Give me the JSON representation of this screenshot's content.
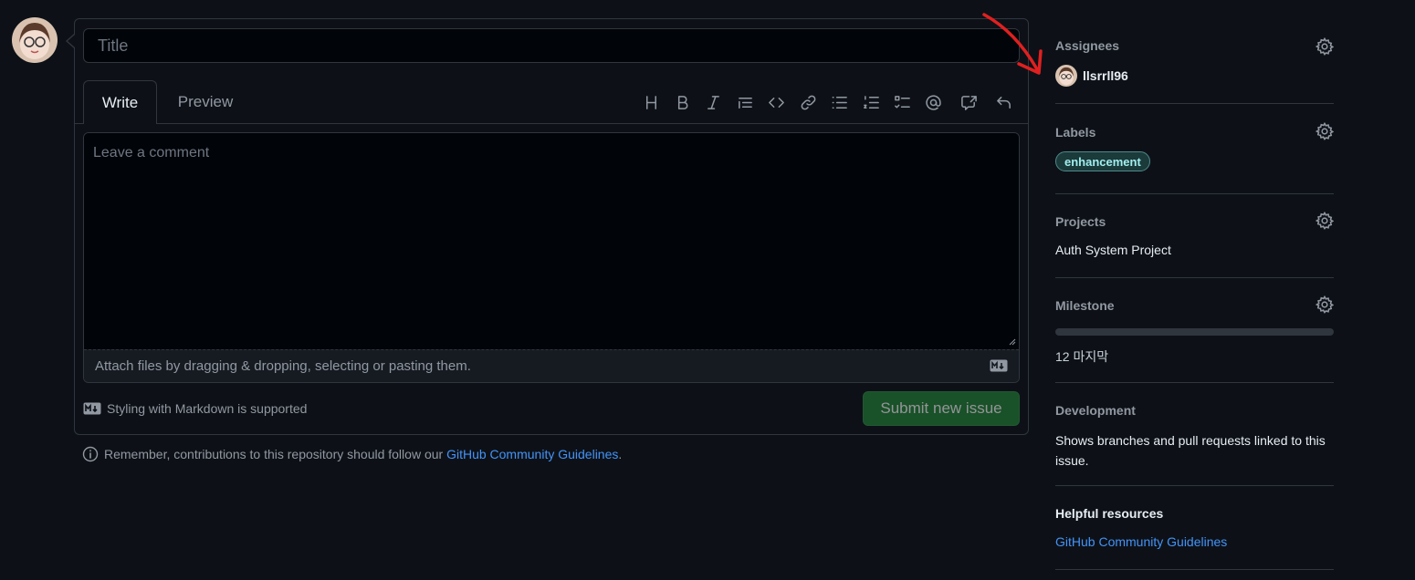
{
  "form": {
    "title_placeholder": "Title",
    "tabs": [
      {
        "label": "Write"
      },
      {
        "label": "Preview"
      }
    ],
    "toolbar_icons": [
      "heading-icon",
      "bold-icon",
      "italic-icon",
      "quote-icon",
      "code-icon",
      "link-icon",
      "unordered-list-icon",
      "ordered-list-icon",
      "task-list-icon",
      "mention-icon",
      "cross-reference-icon",
      "undo-icon"
    ],
    "comment_placeholder": "Leave a comment",
    "attach_text": "Attach files by dragging & dropping, selecting or pasting them.",
    "markdown_note": "Styling with Markdown is supported",
    "submit_label": "Submit new issue"
  },
  "notice": {
    "text": "Remember, contributions to this repository should follow our",
    "link": "GitHub Community Guidelines",
    "end": "."
  },
  "sidebar": {
    "assignees": {
      "heading": "Assignees",
      "user": "llsrrll96"
    },
    "labels": {
      "heading": "Labels",
      "label": "enhancement",
      "color": "#a2eeef"
    },
    "projects": {
      "heading": "Projects",
      "value": "Auth System Project"
    },
    "milestone": {
      "heading": "Milestone",
      "value": "12 마지막",
      "progress": 0
    },
    "development": {
      "heading": "Development",
      "text": "Shows branches and pull requests linked to this issue."
    },
    "helpful": {
      "heading": "Helpful resources",
      "link": "GitHub Community Guidelines"
    }
  },
  "colors": {
    "accent": "#4493f8",
    "submit": "#238636",
    "annotation_arrow": "#e02020"
  }
}
